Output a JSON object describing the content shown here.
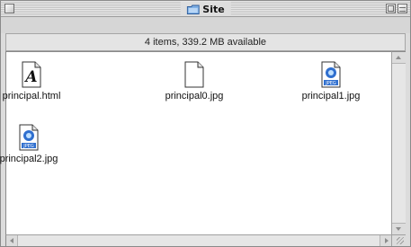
{
  "window": {
    "title": "Site",
    "title_icon": "folder-icon",
    "controls": [
      "close-box",
      "zoom-box",
      "collapse-box"
    ]
  },
  "statusbar": {
    "text": "4 items, 339.2 MB available"
  },
  "files": [
    {
      "name": "principal.html",
      "icon": "html-document-icon"
    },
    {
      "name": "principal0.jpg",
      "icon": "blank-document-icon"
    },
    {
      "name": "principal1.jpg",
      "icon": "jpeg-document-icon"
    },
    {
      "name": "principal2.jpg",
      "icon": "jpeg-document-icon"
    }
  ],
  "colors": {
    "window_bg": "#dcdcdc",
    "content_bg": "#ffffff",
    "jpeg_badge": "#2f6fcf"
  }
}
